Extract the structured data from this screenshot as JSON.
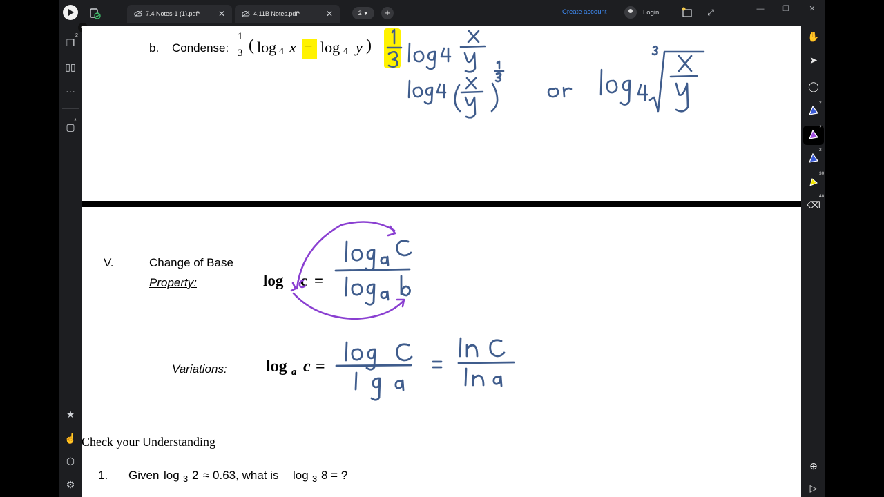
{
  "tabs": [
    {
      "label": "7.4 Notes-1 (1).pdf*"
    },
    {
      "label": "4.11B Notes.pdf*"
    }
  ],
  "toolbar": {
    "page_count": "2",
    "create_account": "Create account",
    "login": "Login"
  },
  "left_rail": {
    "pages_badge": "2",
    "more": "···",
    "new_badge": "*"
  },
  "right_rail": {
    "pen1_size": "2",
    "pen2_size": "2",
    "pen3_size": "2",
    "highlighter_size": "30",
    "eraser_size": "48"
  },
  "icons": {
    "app_logo": "app-logo-icon",
    "cloud_sync": "cloud-sync-icon",
    "hand": "hand-tool-icon",
    "select": "select-arrow-icon",
    "lasso": "lasso-icon",
    "pen": "pen-icon",
    "highlighter": "highlighter-icon",
    "eraser": "eraser-icon",
    "star": "star-icon",
    "gesture": "gesture-icon",
    "settings": "gear-icon"
  },
  "colors": {
    "accent": "#3f8cf5",
    "pen_blue": "#3f5c8c",
    "pen_purple": "#8a3fd1",
    "highlight_yellow": "#fff200"
  },
  "page1": {
    "item_label": "b.",
    "condense_label": "Condense:",
    "frac_num": "1",
    "frac_den": "3",
    "open_paren": "(",
    "log": "log",
    "base": "4",
    "var_x": "x",
    "minus": "−",
    "var_y": "y",
    "close_paren": ")"
  },
  "page2": {
    "section_numeral": "V.",
    "section_title": "Change of Base",
    "property_label": "Property:",
    "eq_log": "log",
    "eq_c": "c",
    "eq_equals": "=",
    "variations_label": "Variations:",
    "var_log": "log",
    "var_base": "a",
    "var_c": "c",
    "var_equals": "=",
    "check_title": "Check your Understanding",
    "q1_number": "1.",
    "q1_given": "Given",
    "q1_log": "log",
    "q1_base1": "3",
    "q1_arg": "2",
    "q1_approx": "≈ 0.63, what is",
    "q1_log2": "log",
    "q1_base2": "3",
    "q1_tail": "8 = ?"
  }
}
